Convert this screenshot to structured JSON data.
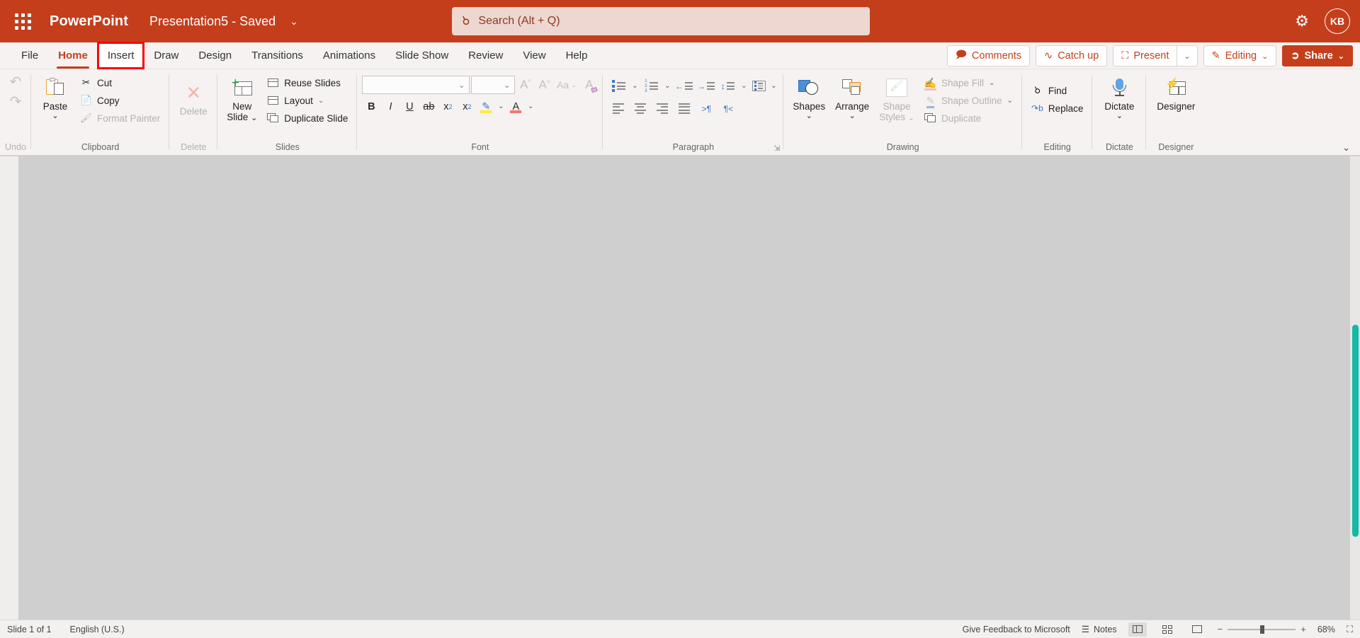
{
  "titlebar": {
    "waffle_icon": "app-launcher-icon",
    "app_name": "PowerPoint",
    "document_title": "Presentation5  -  Saved",
    "title_chevron": "⌄",
    "search": {
      "icon": "search-icon",
      "placeholder": "Search (Alt + Q)",
      "value": ""
    },
    "settings_icon": "gear-icon",
    "avatar_initials": "KB"
  },
  "tabs": [
    {
      "label": "File",
      "state": "normal"
    },
    {
      "label": "Home",
      "state": "active"
    },
    {
      "label": "Insert",
      "state": "highlighted"
    },
    {
      "label": "Draw",
      "state": "normal"
    },
    {
      "label": "Design",
      "state": "normal"
    },
    {
      "label": "Transitions",
      "state": "normal"
    },
    {
      "label": "Animations",
      "state": "normal"
    },
    {
      "label": "Slide Show",
      "state": "normal"
    },
    {
      "label": "Review",
      "state": "normal"
    },
    {
      "label": "View",
      "state": "normal"
    },
    {
      "label": "Help",
      "state": "normal"
    }
  ],
  "tab_actions": {
    "comments": {
      "label": "Comments",
      "icon": "comment-icon"
    },
    "catch_up": {
      "label": "Catch up",
      "icon": "activity-icon"
    },
    "present": {
      "label": "Present",
      "icon": "present-screen-icon",
      "chevron": "⌄"
    },
    "editing": {
      "label": "Editing",
      "icon": "pencil-icon",
      "chevron": "⌄"
    },
    "share": {
      "label": "Share",
      "icon": "share-icon",
      "chevron": "⌄"
    }
  },
  "ribbon": {
    "collapse_chevron": "⌄",
    "groups": {
      "undo": {
        "label": "Undo",
        "undo_icon": "undo-arrow-icon",
        "redo_icon": "redo-arrow-icon"
      },
      "clipboard": {
        "label": "Clipboard",
        "paste": {
          "label": "Paste",
          "chevron": "⌄",
          "icon": "paste-clipboard-icon"
        },
        "cut": {
          "label": "Cut",
          "icon": "scissors-icon"
        },
        "copy": {
          "label": "Copy",
          "icon": "copy-pages-icon"
        },
        "format_painter": {
          "label": "Format Painter",
          "icon": "format-painter-brush-icon",
          "disabled": true
        }
      },
      "delete": {
        "label": "Delete",
        "button": {
          "label": "Delete",
          "icon": "delete-x-icon",
          "disabled": true
        }
      },
      "slides": {
        "label": "Slides",
        "new_slide": {
          "label_line1": "New",
          "label_line2": "Slide",
          "chevron": "⌄",
          "icon": "new-slide-icon"
        },
        "reuse_slides": {
          "label": "Reuse Slides",
          "icon": "reuse-slides-icon"
        },
        "layout": {
          "label": "Layout",
          "chevron": "⌄",
          "icon": "layout-icon"
        },
        "duplicate_slide": {
          "label": "Duplicate Slide",
          "icon": "duplicate-slide-icon"
        }
      },
      "font": {
        "label": "Font",
        "font_name": {
          "value": "",
          "chevron": "⌄"
        },
        "font_size": {
          "value": "",
          "chevron": "⌄"
        },
        "grow_font": {
          "icon": "grow-font-icon",
          "glyph": "A"
        },
        "shrink_font": {
          "icon": "shrink-font-icon",
          "glyph": "A"
        },
        "change_case": {
          "icon": "change-case-icon",
          "glyph": "Aa",
          "chevron": "⌄"
        },
        "clear_formatting": {
          "icon": "clear-formatting-icon",
          "glyph": "A"
        },
        "bold": {
          "icon": "bold-icon",
          "glyph": "B"
        },
        "italic": {
          "icon": "italic-icon",
          "glyph": "I"
        },
        "underline": {
          "icon": "underline-icon",
          "glyph": "U"
        },
        "strikethrough": {
          "icon": "strikethrough-icon",
          "glyph": "ab"
        },
        "subscript": {
          "icon": "subscript-icon",
          "glyph": "x",
          "sub": "2"
        },
        "superscript": {
          "icon": "superscript-icon",
          "glyph": "x",
          "sup": "2"
        },
        "highlight": {
          "icon": "text-highlight-icon",
          "glyph": "✎",
          "chevron": "⌄",
          "color": "#ffeb3b"
        },
        "font_color": {
          "icon": "font-color-icon",
          "glyph": "A",
          "chevron": "⌄",
          "color": "#f2776f"
        }
      },
      "paragraph": {
        "label": "Paragraph",
        "bullets": {
          "icon": "bullet-list-icon",
          "chevron": "⌄"
        },
        "numbering": {
          "icon": "numbered-list-icon",
          "chevron": "⌄"
        },
        "decrease_indent": {
          "icon": "decrease-indent-icon"
        },
        "increase_indent": {
          "icon": "increase-indent-icon"
        },
        "line_spacing": {
          "icon": "line-spacing-icon",
          "chevron": "⌄"
        },
        "columns": {
          "icon": "text-columns-icon",
          "chevron": "⌄"
        },
        "align_left": {
          "icon": "align-left-icon"
        },
        "align_center": {
          "icon": "align-center-icon"
        },
        "align_right": {
          "icon": "align-right-icon"
        },
        "justify": {
          "icon": "justify-icon"
        },
        "ltr": {
          "icon": "left-to-right-icon",
          "glyph": ">¶"
        },
        "rtl": {
          "icon": "right-to-left-icon",
          "glyph": "¶<"
        },
        "dialog_launcher": {
          "icon": "dialog-launcher-icon",
          "glyph": "⇲"
        }
      },
      "drawing": {
        "label": "Drawing",
        "shapes": {
          "label": "Shapes",
          "chevron": "⌄",
          "icon": "shapes-icon"
        },
        "arrange": {
          "label": "Arrange",
          "chevron": "⌄",
          "icon": "arrange-icon"
        },
        "shape_styles": {
          "label_line1": "Shape",
          "label_line2": "Styles",
          "chevron": "⌄",
          "icon": "shape-styles-icon",
          "disabled": true
        },
        "shape_fill": {
          "label": "Shape Fill",
          "chevron": "⌄",
          "icon": "shape-fill-icon",
          "disabled": true
        },
        "shape_outline": {
          "label": "Shape Outline",
          "chevron": "⌄",
          "icon": "shape-outline-icon",
          "disabled": true
        },
        "duplicate": {
          "label": "Duplicate",
          "icon": "duplicate-icon",
          "disabled": true
        }
      },
      "editing": {
        "label": "Editing",
        "find": {
          "label": "Find",
          "icon": "search-icon"
        },
        "replace": {
          "label": "Replace",
          "icon": "replace-icon"
        }
      },
      "dictate": {
        "label": "Dictate",
        "button": {
          "label": "Dictate",
          "chevron": "⌄",
          "icon": "microphone-icon"
        }
      },
      "designer": {
        "label": "Designer",
        "button": {
          "label": "Designer",
          "icon": "designer-icon"
        }
      }
    }
  },
  "canvas": {
    "scrollbar": {
      "thumb_color": "#14b8a6"
    }
  },
  "statusbar": {
    "slide_count": "Slide 1 of 1",
    "language": "English (U.S.)",
    "feedback": "Give Feedback to Microsoft",
    "notes": {
      "label": "Notes",
      "icon": "notes-icon"
    },
    "views": [
      {
        "name": "normal-view",
        "active": true
      },
      {
        "name": "slide-sorter-view",
        "active": false
      },
      {
        "name": "reading-view",
        "active": false
      }
    ],
    "zoom": {
      "minus": "−",
      "plus": "+",
      "level": "68%",
      "fit_icon": "fit-slide-icon"
    }
  }
}
